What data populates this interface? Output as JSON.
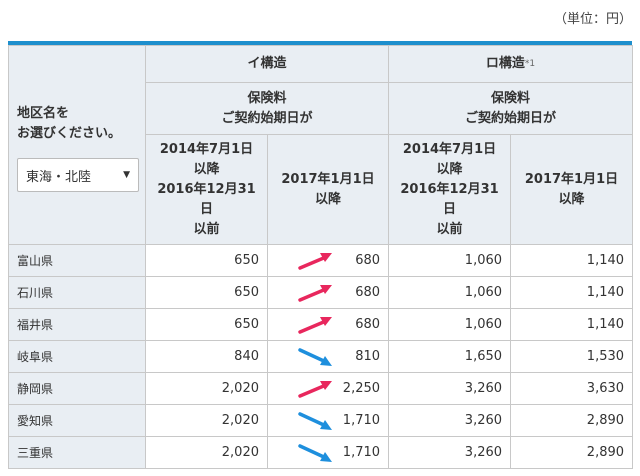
{
  "unit_label": "（単位：円）",
  "side": {
    "label_line1": "地区名を",
    "label_line2": "お選びください。",
    "region_select": "東海・北陸"
  },
  "groups": [
    {
      "title": "イ構造",
      "sup": ""
    },
    {
      "title": "ロ構造",
      "sup": "*1"
    }
  ],
  "subheader": {
    "line1": "保険料",
    "line2": "ご契約始期日が"
  },
  "periods": [
    [
      "2014年7月1日",
      "以降",
      "2016年12月31",
      "日",
      "以前"
    ],
    [
      "2017年1月1日",
      "以降"
    ],
    [
      "2014年7月1日",
      "以降",
      "2016年12月31",
      "日",
      "以前"
    ],
    [
      "2017年1月1日",
      "以降"
    ]
  ],
  "arrow_colors": {
    "up": "#e8275d",
    "down": "#1e8fdd"
  },
  "rows": [
    {
      "name": "富山県",
      "i_old": "650",
      "i_new": "680",
      "trend": "up",
      "ro_old": "1,060",
      "ro_new": "1,140"
    },
    {
      "name": "石川県",
      "i_old": "650",
      "i_new": "680",
      "trend": "up",
      "ro_old": "1,060",
      "ro_new": "1,140"
    },
    {
      "name": "福井県",
      "i_old": "650",
      "i_new": "680",
      "trend": "up",
      "ro_old": "1,060",
      "ro_new": "1,140"
    },
    {
      "name": "岐阜県",
      "i_old": "840",
      "i_new": "810",
      "trend": "down",
      "ro_old": "1,650",
      "ro_new": "1,530"
    },
    {
      "name": "静岡県",
      "i_old": "2,020",
      "i_new": "2,250",
      "trend": "up",
      "ro_old": "3,260",
      "ro_new": "3,630"
    },
    {
      "name": "愛知県",
      "i_old": "2,020",
      "i_new": "1,710",
      "trend": "down",
      "ro_old": "3,260",
      "ro_new": "2,890"
    },
    {
      "name": "三重県",
      "i_old": "2,020",
      "i_new": "1,710",
      "trend": "down",
      "ro_old": "3,260",
      "ro_new": "2,890"
    }
  ]
}
